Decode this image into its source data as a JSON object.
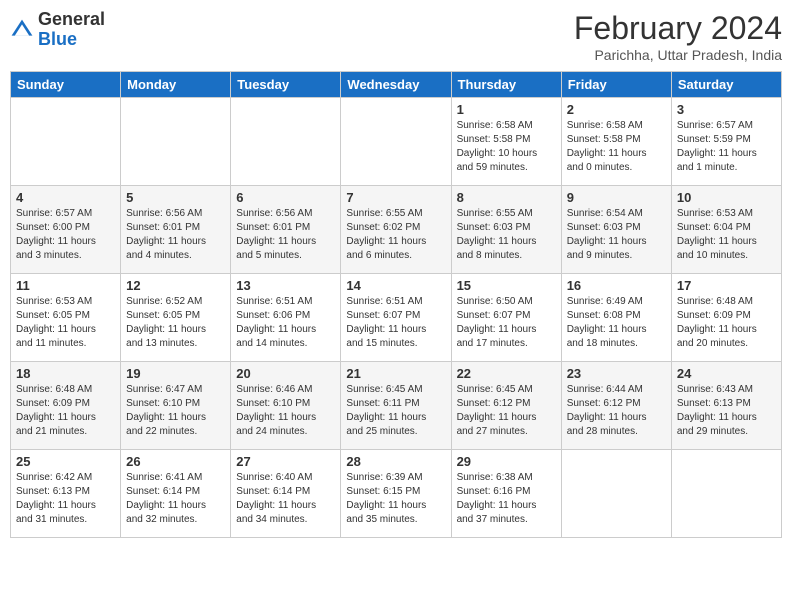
{
  "logo": {
    "general": "General",
    "blue": "Blue"
  },
  "title": {
    "month_year": "February 2024",
    "location": "Parichha, Uttar Pradesh, India"
  },
  "days_of_week": [
    "Sunday",
    "Monday",
    "Tuesday",
    "Wednesday",
    "Thursday",
    "Friday",
    "Saturday"
  ],
  "weeks": [
    [
      {
        "day": "",
        "info": ""
      },
      {
        "day": "",
        "info": ""
      },
      {
        "day": "",
        "info": ""
      },
      {
        "day": "",
        "info": ""
      },
      {
        "day": "1",
        "info": "Sunrise: 6:58 AM\nSunset: 5:58 PM\nDaylight: 10 hours and 59 minutes."
      },
      {
        "day": "2",
        "info": "Sunrise: 6:58 AM\nSunset: 5:58 PM\nDaylight: 11 hours and 0 minutes."
      },
      {
        "day": "3",
        "info": "Sunrise: 6:57 AM\nSunset: 5:59 PM\nDaylight: 11 hours and 1 minute."
      }
    ],
    [
      {
        "day": "4",
        "info": "Sunrise: 6:57 AM\nSunset: 6:00 PM\nDaylight: 11 hours and 3 minutes."
      },
      {
        "day": "5",
        "info": "Sunrise: 6:56 AM\nSunset: 6:01 PM\nDaylight: 11 hours and 4 minutes."
      },
      {
        "day": "6",
        "info": "Sunrise: 6:56 AM\nSunset: 6:01 PM\nDaylight: 11 hours and 5 minutes."
      },
      {
        "day": "7",
        "info": "Sunrise: 6:55 AM\nSunset: 6:02 PM\nDaylight: 11 hours and 6 minutes."
      },
      {
        "day": "8",
        "info": "Sunrise: 6:55 AM\nSunset: 6:03 PM\nDaylight: 11 hours and 8 minutes."
      },
      {
        "day": "9",
        "info": "Sunrise: 6:54 AM\nSunset: 6:03 PM\nDaylight: 11 hours and 9 minutes."
      },
      {
        "day": "10",
        "info": "Sunrise: 6:53 AM\nSunset: 6:04 PM\nDaylight: 11 hours and 10 minutes."
      }
    ],
    [
      {
        "day": "11",
        "info": "Sunrise: 6:53 AM\nSunset: 6:05 PM\nDaylight: 11 hours and 11 minutes."
      },
      {
        "day": "12",
        "info": "Sunrise: 6:52 AM\nSunset: 6:05 PM\nDaylight: 11 hours and 13 minutes."
      },
      {
        "day": "13",
        "info": "Sunrise: 6:51 AM\nSunset: 6:06 PM\nDaylight: 11 hours and 14 minutes."
      },
      {
        "day": "14",
        "info": "Sunrise: 6:51 AM\nSunset: 6:07 PM\nDaylight: 11 hours and 15 minutes."
      },
      {
        "day": "15",
        "info": "Sunrise: 6:50 AM\nSunset: 6:07 PM\nDaylight: 11 hours and 17 minutes."
      },
      {
        "day": "16",
        "info": "Sunrise: 6:49 AM\nSunset: 6:08 PM\nDaylight: 11 hours and 18 minutes."
      },
      {
        "day": "17",
        "info": "Sunrise: 6:48 AM\nSunset: 6:09 PM\nDaylight: 11 hours and 20 minutes."
      }
    ],
    [
      {
        "day": "18",
        "info": "Sunrise: 6:48 AM\nSunset: 6:09 PM\nDaylight: 11 hours and 21 minutes."
      },
      {
        "day": "19",
        "info": "Sunrise: 6:47 AM\nSunset: 6:10 PM\nDaylight: 11 hours and 22 minutes."
      },
      {
        "day": "20",
        "info": "Sunrise: 6:46 AM\nSunset: 6:10 PM\nDaylight: 11 hours and 24 minutes."
      },
      {
        "day": "21",
        "info": "Sunrise: 6:45 AM\nSunset: 6:11 PM\nDaylight: 11 hours and 25 minutes."
      },
      {
        "day": "22",
        "info": "Sunrise: 6:45 AM\nSunset: 6:12 PM\nDaylight: 11 hours and 27 minutes."
      },
      {
        "day": "23",
        "info": "Sunrise: 6:44 AM\nSunset: 6:12 PM\nDaylight: 11 hours and 28 minutes."
      },
      {
        "day": "24",
        "info": "Sunrise: 6:43 AM\nSunset: 6:13 PM\nDaylight: 11 hours and 29 minutes."
      }
    ],
    [
      {
        "day": "25",
        "info": "Sunrise: 6:42 AM\nSunset: 6:13 PM\nDaylight: 11 hours and 31 minutes."
      },
      {
        "day": "26",
        "info": "Sunrise: 6:41 AM\nSunset: 6:14 PM\nDaylight: 11 hours and 32 minutes."
      },
      {
        "day": "27",
        "info": "Sunrise: 6:40 AM\nSunset: 6:14 PM\nDaylight: 11 hours and 34 minutes."
      },
      {
        "day": "28",
        "info": "Sunrise: 6:39 AM\nSunset: 6:15 PM\nDaylight: 11 hours and 35 minutes."
      },
      {
        "day": "29",
        "info": "Sunrise: 6:38 AM\nSunset: 6:16 PM\nDaylight: 11 hours and 37 minutes."
      },
      {
        "day": "",
        "info": ""
      },
      {
        "day": "",
        "info": ""
      }
    ]
  ]
}
